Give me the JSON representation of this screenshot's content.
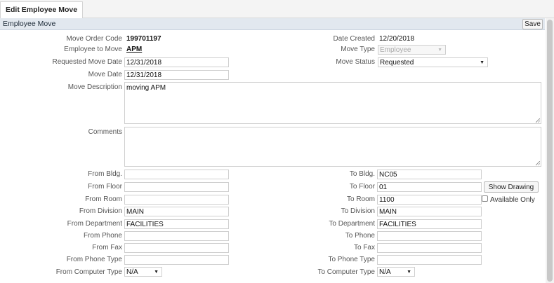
{
  "tab": {
    "label": "Edit Employee Move"
  },
  "panel": {
    "title": "Employee Move",
    "save_label": "Save"
  },
  "fields": {
    "move_order_code": {
      "label": "Move Order Code",
      "value": "199701197"
    },
    "employee_to_move": {
      "label": "Employee to Move",
      "value": "APM"
    },
    "requested_move_date": {
      "label": "Requested Move Date",
      "value": "12/31/2018"
    },
    "move_date": {
      "label": "Move Date",
      "value": "12/31/2018"
    },
    "move_description": {
      "label": "Move Description",
      "value": "moving APM"
    },
    "comments": {
      "label": "Comments",
      "value": ""
    },
    "date_created": {
      "label": "Date Created",
      "value": "12/20/2018"
    },
    "move_type": {
      "label": "Move Type",
      "value": "Employee"
    },
    "move_status": {
      "label": "Move Status",
      "value": "Requested"
    },
    "from_bldg": {
      "label": "From Bldg.",
      "value": ""
    },
    "from_floor": {
      "label": "From Floor",
      "value": ""
    },
    "from_room": {
      "label": "From Room",
      "value": ""
    },
    "from_division": {
      "label": "From Division",
      "value": "MAIN"
    },
    "from_department": {
      "label": "From Department",
      "value": "FACILITIES"
    },
    "from_phone": {
      "label": "From Phone",
      "value": ""
    },
    "from_fax": {
      "label": "From Fax",
      "value": ""
    },
    "from_phone_type": {
      "label": "From Phone Type",
      "value": ""
    },
    "from_computer_type": {
      "label": "From Computer Type",
      "value": "N/A"
    },
    "to_bldg": {
      "label": "To Bldg.",
      "value": "NC05"
    },
    "to_floor": {
      "label": "To Floor",
      "value": "01"
    },
    "to_room": {
      "label": "To Room",
      "value": "1100"
    },
    "to_division": {
      "label": "To Division",
      "value": "MAIN"
    },
    "to_department": {
      "label": "To Department",
      "value": "FACILITIES"
    },
    "to_phone": {
      "label": "To Phone",
      "value": ""
    },
    "to_fax": {
      "label": "To Fax",
      "value": ""
    },
    "to_phone_type": {
      "label": "To Phone Type",
      "value": ""
    },
    "to_computer_type": {
      "label": "To Computer Type",
      "value": "N/A"
    }
  },
  "show_drawing_label": "Show Drawing",
  "available_only_label": "Available Only",
  "icons": {
    "dropdown": "chevron-down-icon",
    "resize": "resize-grip-icon"
  }
}
